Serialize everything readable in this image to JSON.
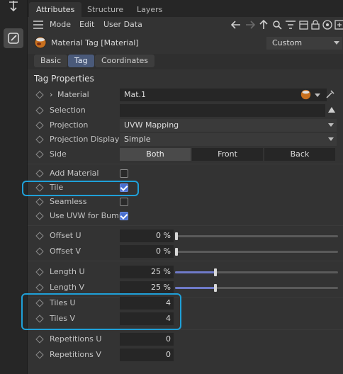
{
  "tabs": [
    "Attributes",
    "Structure",
    "Layers"
  ],
  "menu": [
    "Mode",
    "Edit",
    "User Data"
  ],
  "header": {
    "title": "Material Tag [Material]",
    "preset": "Custom"
  },
  "subtabs": [
    "Basic",
    "Tag",
    "Coordinates"
  ],
  "section_title": "Tag Properties",
  "fields": {
    "material": {
      "label": "Material",
      "value": "Mat.1"
    },
    "selection": {
      "label": "Selection",
      "value": ""
    },
    "projection": {
      "label": "Projection",
      "value": "UVW Mapping"
    },
    "projection_display": {
      "label": "Projection Display",
      "value": "Simple"
    },
    "side": {
      "label": "Side",
      "options": [
        "Both",
        "Front",
        "Back"
      ],
      "selected": "Both"
    },
    "add_material": {
      "label": "Add Material",
      "checked": false
    },
    "tile": {
      "label": "Tile",
      "checked": true
    },
    "seamless": {
      "label": "Seamless",
      "checked": false
    },
    "use_uvw_for_bump": {
      "label": "Use UVW for Bump",
      "checked": true
    },
    "offset_u": {
      "label": "Offset U",
      "value": "0 %",
      "fraction": 0
    },
    "offset_v": {
      "label": "Offset V",
      "value": "0 %",
      "fraction": 0
    },
    "length_u": {
      "label": "Length U",
      "value": "25 %",
      "fraction": 0.25
    },
    "length_v": {
      "label": "Length V",
      "value": "25 %",
      "fraction": 0.25
    },
    "tiles_u": {
      "label": "Tiles U",
      "value": "4"
    },
    "tiles_v": {
      "label": "Tiles V",
      "value": "4"
    },
    "repetitions_u": {
      "label": "Repetitions U",
      "value": "0"
    },
    "repetitions_v": {
      "label": "Repetitions V",
      "value": "0"
    }
  },
  "colors": {
    "highlight": "#1fa0d8",
    "accent": "#4a6fd0",
    "slider_fill": "#6f7ac8"
  }
}
